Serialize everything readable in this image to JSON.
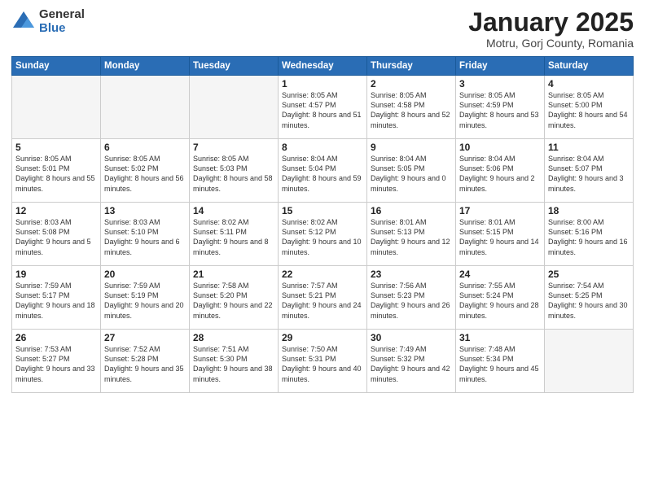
{
  "header": {
    "logo_general": "General",
    "logo_blue": "Blue",
    "month_title": "January 2025",
    "subtitle": "Motru, Gorj County, Romania"
  },
  "weekdays": [
    "Sunday",
    "Monday",
    "Tuesday",
    "Wednesday",
    "Thursday",
    "Friday",
    "Saturday"
  ],
  "weeks": [
    [
      {
        "day": "",
        "info": ""
      },
      {
        "day": "",
        "info": ""
      },
      {
        "day": "",
        "info": ""
      },
      {
        "day": "1",
        "info": "Sunrise: 8:05 AM\nSunset: 4:57 PM\nDaylight: 8 hours\nand 51 minutes."
      },
      {
        "day": "2",
        "info": "Sunrise: 8:05 AM\nSunset: 4:58 PM\nDaylight: 8 hours\nand 52 minutes."
      },
      {
        "day": "3",
        "info": "Sunrise: 8:05 AM\nSunset: 4:59 PM\nDaylight: 8 hours\nand 53 minutes."
      },
      {
        "day": "4",
        "info": "Sunrise: 8:05 AM\nSunset: 5:00 PM\nDaylight: 8 hours\nand 54 minutes."
      }
    ],
    [
      {
        "day": "5",
        "info": "Sunrise: 8:05 AM\nSunset: 5:01 PM\nDaylight: 8 hours\nand 55 minutes."
      },
      {
        "day": "6",
        "info": "Sunrise: 8:05 AM\nSunset: 5:02 PM\nDaylight: 8 hours\nand 56 minutes."
      },
      {
        "day": "7",
        "info": "Sunrise: 8:05 AM\nSunset: 5:03 PM\nDaylight: 8 hours\nand 58 minutes."
      },
      {
        "day": "8",
        "info": "Sunrise: 8:04 AM\nSunset: 5:04 PM\nDaylight: 8 hours\nand 59 minutes."
      },
      {
        "day": "9",
        "info": "Sunrise: 8:04 AM\nSunset: 5:05 PM\nDaylight: 9 hours\nand 0 minutes."
      },
      {
        "day": "10",
        "info": "Sunrise: 8:04 AM\nSunset: 5:06 PM\nDaylight: 9 hours\nand 2 minutes."
      },
      {
        "day": "11",
        "info": "Sunrise: 8:04 AM\nSunset: 5:07 PM\nDaylight: 9 hours\nand 3 minutes."
      }
    ],
    [
      {
        "day": "12",
        "info": "Sunrise: 8:03 AM\nSunset: 5:08 PM\nDaylight: 9 hours\nand 5 minutes."
      },
      {
        "day": "13",
        "info": "Sunrise: 8:03 AM\nSunset: 5:10 PM\nDaylight: 9 hours\nand 6 minutes."
      },
      {
        "day": "14",
        "info": "Sunrise: 8:02 AM\nSunset: 5:11 PM\nDaylight: 9 hours\nand 8 minutes."
      },
      {
        "day": "15",
        "info": "Sunrise: 8:02 AM\nSunset: 5:12 PM\nDaylight: 9 hours\nand 10 minutes."
      },
      {
        "day": "16",
        "info": "Sunrise: 8:01 AM\nSunset: 5:13 PM\nDaylight: 9 hours\nand 12 minutes."
      },
      {
        "day": "17",
        "info": "Sunrise: 8:01 AM\nSunset: 5:15 PM\nDaylight: 9 hours\nand 14 minutes."
      },
      {
        "day": "18",
        "info": "Sunrise: 8:00 AM\nSunset: 5:16 PM\nDaylight: 9 hours\nand 16 minutes."
      }
    ],
    [
      {
        "day": "19",
        "info": "Sunrise: 7:59 AM\nSunset: 5:17 PM\nDaylight: 9 hours\nand 18 minutes."
      },
      {
        "day": "20",
        "info": "Sunrise: 7:59 AM\nSunset: 5:19 PM\nDaylight: 9 hours\nand 20 minutes."
      },
      {
        "day": "21",
        "info": "Sunrise: 7:58 AM\nSunset: 5:20 PM\nDaylight: 9 hours\nand 22 minutes."
      },
      {
        "day": "22",
        "info": "Sunrise: 7:57 AM\nSunset: 5:21 PM\nDaylight: 9 hours\nand 24 minutes."
      },
      {
        "day": "23",
        "info": "Sunrise: 7:56 AM\nSunset: 5:23 PM\nDaylight: 9 hours\nand 26 minutes."
      },
      {
        "day": "24",
        "info": "Sunrise: 7:55 AM\nSunset: 5:24 PM\nDaylight: 9 hours\nand 28 minutes."
      },
      {
        "day": "25",
        "info": "Sunrise: 7:54 AM\nSunset: 5:25 PM\nDaylight: 9 hours\nand 30 minutes."
      }
    ],
    [
      {
        "day": "26",
        "info": "Sunrise: 7:53 AM\nSunset: 5:27 PM\nDaylight: 9 hours\nand 33 minutes."
      },
      {
        "day": "27",
        "info": "Sunrise: 7:52 AM\nSunset: 5:28 PM\nDaylight: 9 hours\nand 35 minutes."
      },
      {
        "day": "28",
        "info": "Sunrise: 7:51 AM\nSunset: 5:30 PM\nDaylight: 9 hours\nand 38 minutes."
      },
      {
        "day": "29",
        "info": "Sunrise: 7:50 AM\nSunset: 5:31 PM\nDaylight: 9 hours\nand 40 minutes."
      },
      {
        "day": "30",
        "info": "Sunrise: 7:49 AM\nSunset: 5:32 PM\nDaylight: 9 hours\nand 42 minutes."
      },
      {
        "day": "31",
        "info": "Sunrise: 7:48 AM\nSunset: 5:34 PM\nDaylight: 9 hours\nand 45 minutes."
      },
      {
        "day": "",
        "info": ""
      }
    ]
  ]
}
